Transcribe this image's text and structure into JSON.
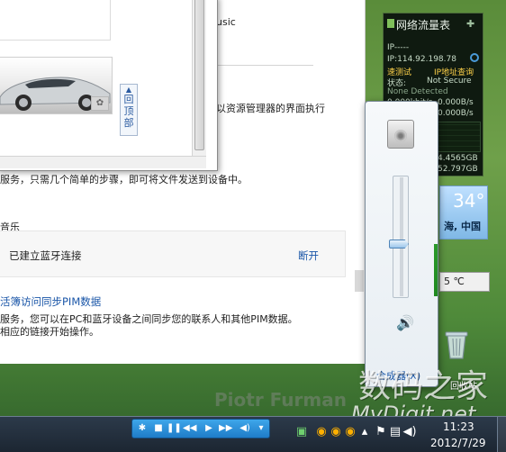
{
  "main": {
    "top_right_text": "usic",
    "explorer_text": "以资源管理器的界面执行",
    "steps_text": "服务，只需几个简单的步骤，即可将文件发送到设备中。",
    "music_section_label": "音乐",
    "bt_connected": "已建立蓝牙连接",
    "disconnect": "断开",
    "pim_link": "活簿访问同步PIM数据",
    "pim_desc_1": "服务，您可以在PC和蓝牙设备之间同步您的联系人和其他PIM数据。",
    "pim_desc_2": "相应的链接开始操作。"
  },
  "dialog": {
    "back_to_top": [
      "回",
      "顶",
      "部"
    ]
  },
  "net_gadget": {
    "title": "网络流量表",
    "ip_label": "IP-----",
    "ip_value": "IP:114.92.198.78",
    "test_label": "速测试",
    "query_label": "IP地址查询",
    "security_label": "状态:",
    "security_value": "Not Secure",
    "nd_value": "None Detected",
    "rate_1": "0.000kbit/s",
    "rate_2": "0.000B/s",
    "rate_3": "0.000B/s",
    "gb_1": "4.4565GB",
    "gb_2": "52.797GB"
  },
  "weather": {
    "temp": "34°",
    "location": "海, 中国"
  },
  "cpu_temp": {
    "value": "5 ℃"
  },
  "desktop": {
    "recycle_label": "回收站"
  },
  "volume": {
    "level_percent": 44,
    "mixer_link": "合成器(X)"
  },
  "watermark": {
    "name": "Piotr Furman",
    "cn": "数码之家",
    "site": "MyDigit.net"
  },
  "taskbar": {
    "time": "11:23",
    "date": "2012/7/29"
  },
  "colors": {
    "link": "#1a56a8",
    "volume_fill": "#2a9a2a",
    "taskbar": "#1c2632",
    "media_toolbar": "#1f7cc8"
  }
}
